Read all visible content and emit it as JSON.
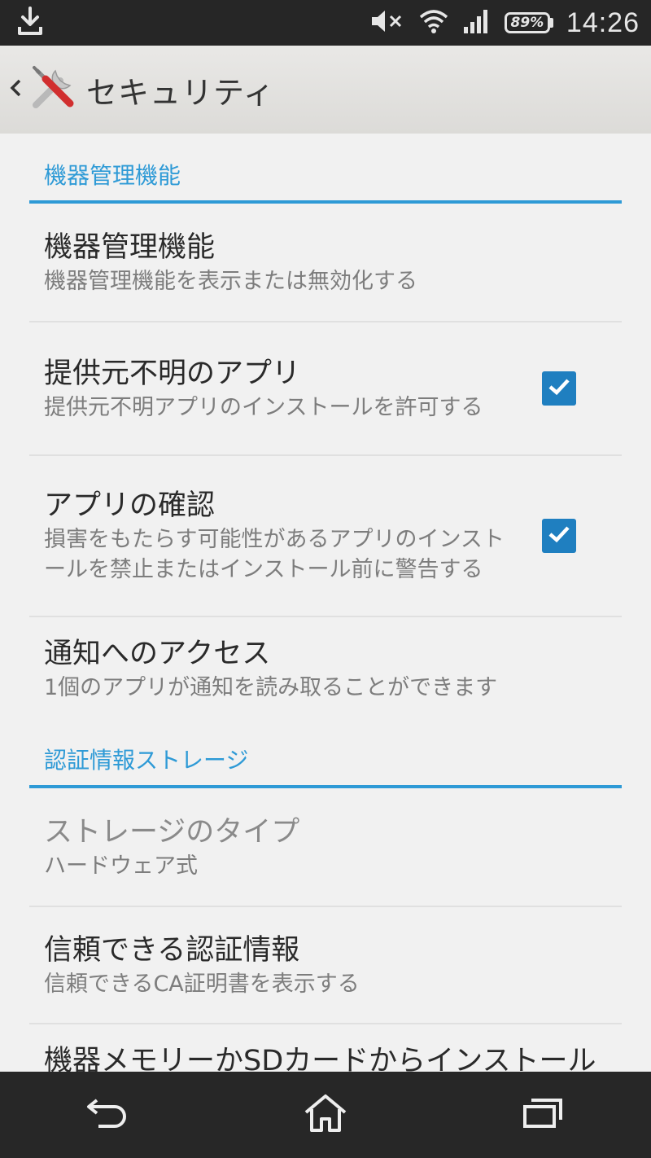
{
  "status_bar": {
    "time": "14:26",
    "battery": "89%",
    "icons": [
      "download-icon",
      "mute-icon",
      "wifi-icon",
      "signal-icon",
      "battery-icon"
    ]
  },
  "action_bar": {
    "title": "セキュリティ",
    "icon": "tools-icon"
  },
  "sections": [
    {
      "header": "機器管理機能",
      "items": [
        {
          "title": "機器管理機能",
          "summary": "機器管理機能を表示または無効化する"
        },
        {
          "title": "提供元不明のアプリ",
          "summary": "提供元不明アプリのインストールを許可する",
          "checked": true
        },
        {
          "title": "アプリの確認",
          "summary": "損害をもたらす可能性があるアプリのインストールを禁止またはインストール前に警告する",
          "checked": true
        },
        {
          "title": "通知へのアクセス",
          "summary": "1個のアプリが通知を読み取ることができます"
        }
      ]
    },
    {
      "header": "認証情報ストレージ",
      "items": [
        {
          "title": "ストレージのタイプ",
          "summary": "ハードウェア式"
        },
        {
          "title": "信頼できる認証情報",
          "summary": "信頼できるCA証明書を表示する"
        },
        {
          "title": "機器メモリーかSDカードからインストール"
        }
      ]
    }
  ],
  "nav_bar": {
    "buttons": [
      "back-icon",
      "home-icon",
      "recent-apps-icon"
    ]
  },
  "colors": {
    "accent": "#2e9ad6",
    "checkbox": "#1f7fc0",
    "status_bar": "#262626"
  }
}
